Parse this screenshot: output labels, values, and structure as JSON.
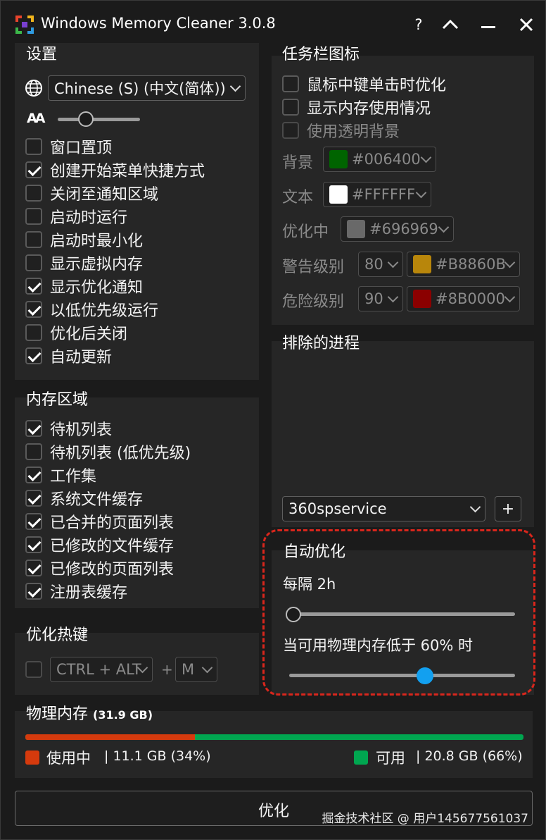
{
  "window": {
    "title": "Windows Memory Cleaner 3.0.8",
    "help_label": "?"
  },
  "settings": {
    "title": "设置",
    "language": "Chinese (S) (中文(简体))",
    "font_size_icon": "AA",
    "font_size_level": 0.3,
    "options": [
      {
        "label": "窗口置顶",
        "checked": false
      },
      {
        "label": "创建开始菜单快捷方式",
        "checked": true
      },
      {
        "label": "关闭至通知区域",
        "checked": false
      },
      {
        "label": "启动时运行",
        "checked": false
      },
      {
        "label": "启动时最小化",
        "checked": false
      },
      {
        "label": "显示虚拟内存",
        "checked": false
      },
      {
        "label": "显示优化通知",
        "checked": true
      },
      {
        "label": "以低优先级运行",
        "checked": true
      },
      {
        "label": "优化后关闭",
        "checked": false
      },
      {
        "label": "自动更新",
        "checked": true
      }
    ]
  },
  "memory_areas": {
    "title": "内存区域",
    "options": [
      {
        "label": "待机列表",
        "checked": true
      },
      {
        "label": "待机列表 (低优先级)",
        "checked": false
      },
      {
        "label": "工作集",
        "checked": true
      },
      {
        "label": "系统文件缓存",
        "checked": true
      },
      {
        "label": "已合并的页面列表",
        "checked": true
      },
      {
        "label": "已修改的文件缓存",
        "checked": true
      },
      {
        "label": "已修改的页面列表",
        "checked": true
      },
      {
        "label": "注册表缓存",
        "checked": true
      }
    ]
  },
  "hotkey": {
    "title": "优化热键",
    "modifier": "CTRL + ALT",
    "plus": "+",
    "key": "M"
  },
  "tray": {
    "title": "任务栏图标",
    "options": [
      {
        "label": "鼠标中键单击时优化",
        "checked": false
      },
      {
        "label": "显示内存使用情况",
        "checked": false
      },
      {
        "label": "使用透明背景",
        "checked": false
      }
    ],
    "background_label": "背景",
    "background_color": "#006400",
    "text_label": "文本",
    "text_color": "#FFFFFF",
    "optimizing_label": "优化中",
    "optimizing_color": "#696969",
    "warning_label": "警告级别",
    "warning_level": "80",
    "warning_color": "#B8860B",
    "danger_label": "危险级别",
    "danger_level": "90",
    "danger_color": "#8B0000"
  },
  "excluded": {
    "title": "排除的进程",
    "process": "360spservice",
    "add_label": "+"
  },
  "auto_opt": {
    "title": "自动优化",
    "interval_label": "每隔 2h",
    "interval_level": 0.0,
    "threshold_label": "当可用物理内存低于 60% 时",
    "threshold_level": 0.6
  },
  "physical": {
    "title": "物理内存",
    "total": "(31.9 GB)",
    "used_label": "使用中",
    "used_value": "| 11.1 GB (34%)",
    "used_fraction": 0.34,
    "free_label": "可用",
    "free_value": "| 20.8 GB (66%)",
    "used_color": "#D53A0D",
    "free_color": "#00A650"
  },
  "optimize_button": "优化",
  "watermark": "掘金技术社区 @ 用户145677561037"
}
